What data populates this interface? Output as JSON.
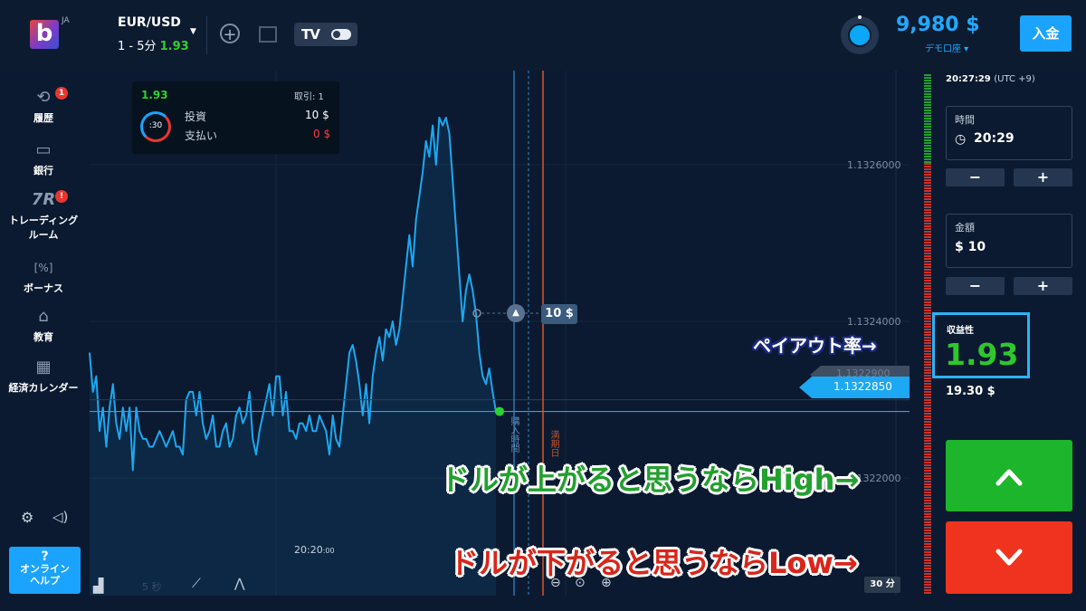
{
  "header": {
    "logo_letter": "b",
    "logo_lang": "JA",
    "pair": "EUR/USD",
    "timeframe": "1 - 5分",
    "payout": "1.93",
    "add_icon": "+",
    "tv_logo": "TV",
    "balance": "9,980 $",
    "account_type": "デモ口座",
    "deposit_label": "入金"
  },
  "sidebar": {
    "items": [
      {
        "icon": "history-icon",
        "label": "履歴",
        "badge": "1"
      },
      {
        "icon": "wallet-icon",
        "label": "銀行"
      },
      {
        "icon": "trading-room-icon",
        "label": "トレーディング\nルーム",
        "label1": "トレーディング",
        "label2": "ルーム",
        "badge": "!"
      },
      {
        "icon": "bonus-icon",
        "label": "ボーナス"
      },
      {
        "icon": "education-icon",
        "label": "教育"
      },
      {
        "icon": "calendar-icon",
        "label": "経済カレンダー"
      }
    ],
    "help_label1": "?",
    "help_label2": "オンライン",
    "help_label3": "ヘルプ"
  },
  "trade_panel": {
    "payout": "1.93",
    "trades_label": "取引: 1",
    "timer": ":30",
    "invest_label": "投資",
    "invest_value": "10 $",
    "payout_label": "支払い",
    "payout_value": "0 $"
  },
  "chart": {
    "current_price": "1.1322850",
    "hidden_price": "1.1322900",
    "bet_label": "10 $",
    "time_label": "20:20",
    "time_label_sec": ":00",
    "purchase_line_label": "購入時間",
    "expiry_line_label": "満期日",
    "zoom_label": "30 分",
    "toolbar_timeframe": "5 秒",
    "colors": {
      "line": "#1ca8f2",
      "up": "#1cb52b",
      "down": "#f0331f"
    }
  },
  "chart_data": {
    "type": "line",
    "title": "",
    "xlabel": "",
    "ylabel": "",
    "x_tick_labels": [
      "20:20:00"
    ],
    "y_ticks": [
      1.1322,
      1.1324,
      1.1326
    ],
    "y_tick_labels": [
      "1.1322000",
      "1.1324000",
      "1.1326000"
    ],
    "ylim": [
      1.13205,
      1.13272
    ],
    "current_price": 1.132285,
    "series": [
      {
        "values": [
          1.13236,
          1.13231,
          1.13233,
          1.13226,
          1.13229,
          1.13224,
          1.13229,
          1.13232,
          1.13227,
          1.13225,
          1.13229,
          1.13226,
          1.13229,
          1.13221,
          1.13229,
          1.13226,
          1.13225,
          1.13225,
          1.13224,
          1.13224,
          1.13225,
          1.13226,
          1.13225,
          1.13224,
          1.13225,
          1.13226,
          1.13224,
          1.13224,
          1.13223,
          1.1323,
          1.13231,
          1.13231,
          1.13228,
          1.13231,
          1.13227,
          1.13225,
          1.13226,
          1.13228,
          1.13224,
          1.13224,
          1.13226,
          1.13227,
          1.13224,
          1.13225,
          1.13228,
          1.13229,
          1.13227,
          1.13228,
          1.13231,
          1.13225,
          1.13223,
          1.13226,
          1.13228,
          1.1323,
          1.13232,
          1.13228,
          1.13233,
          1.13233,
          1.13228,
          1.13231,
          1.13226,
          1.13226,
          1.13225,
          1.13227,
          1.13227,
          1.13226,
          1.13228,
          1.13226,
          1.13226,
          1.13228,
          1.13227,
          1.13226,
          1.13223,
          1.13228,
          1.13225,
          1.13224,
          1.13228,
          1.13232,
          1.13236,
          1.13237,
          1.13235,
          1.13232,
          1.13228,
          1.13232,
          1.13227,
          1.13233,
          1.13236,
          1.13238,
          1.13235,
          1.13239,
          1.13238,
          1.1324,
          1.13237,
          1.13239,
          1.13243,
          1.13247,
          1.13251,
          1.13247,
          1.13253,
          1.13256,
          1.13259,
          1.13263,
          1.13261,
          1.13265,
          1.1326,
          1.13266,
          1.13265,
          1.13266,
          1.13264,
          1.13258,
          1.13252,
          1.13246,
          1.1324,
          1.13244,
          1.13246,
          1.13244,
          1.13241,
          1.13236,
          1.13233,
          1.13232,
          1.13234,
          1.13231,
          1.132285
        ]
      }
    ]
  },
  "right_panel": {
    "server_time": "20:27:29",
    "timezone": "(UTC +9)",
    "time_label": "時間",
    "time_value": "20:29",
    "amount_label": "金額",
    "amount_value": "$ 10",
    "minus": "−",
    "plus": "+",
    "profit_label": "収益性",
    "profit_value": "1.93",
    "profit_amount": "19.30 $",
    "high_arrow": "⌃",
    "low_arrow": "⌄"
  },
  "annotations": {
    "payout": "ペイアウト率→",
    "high": "ドルが上がると思うならHigh→",
    "low": "ドルが下がると思うならLow→"
  }
}
